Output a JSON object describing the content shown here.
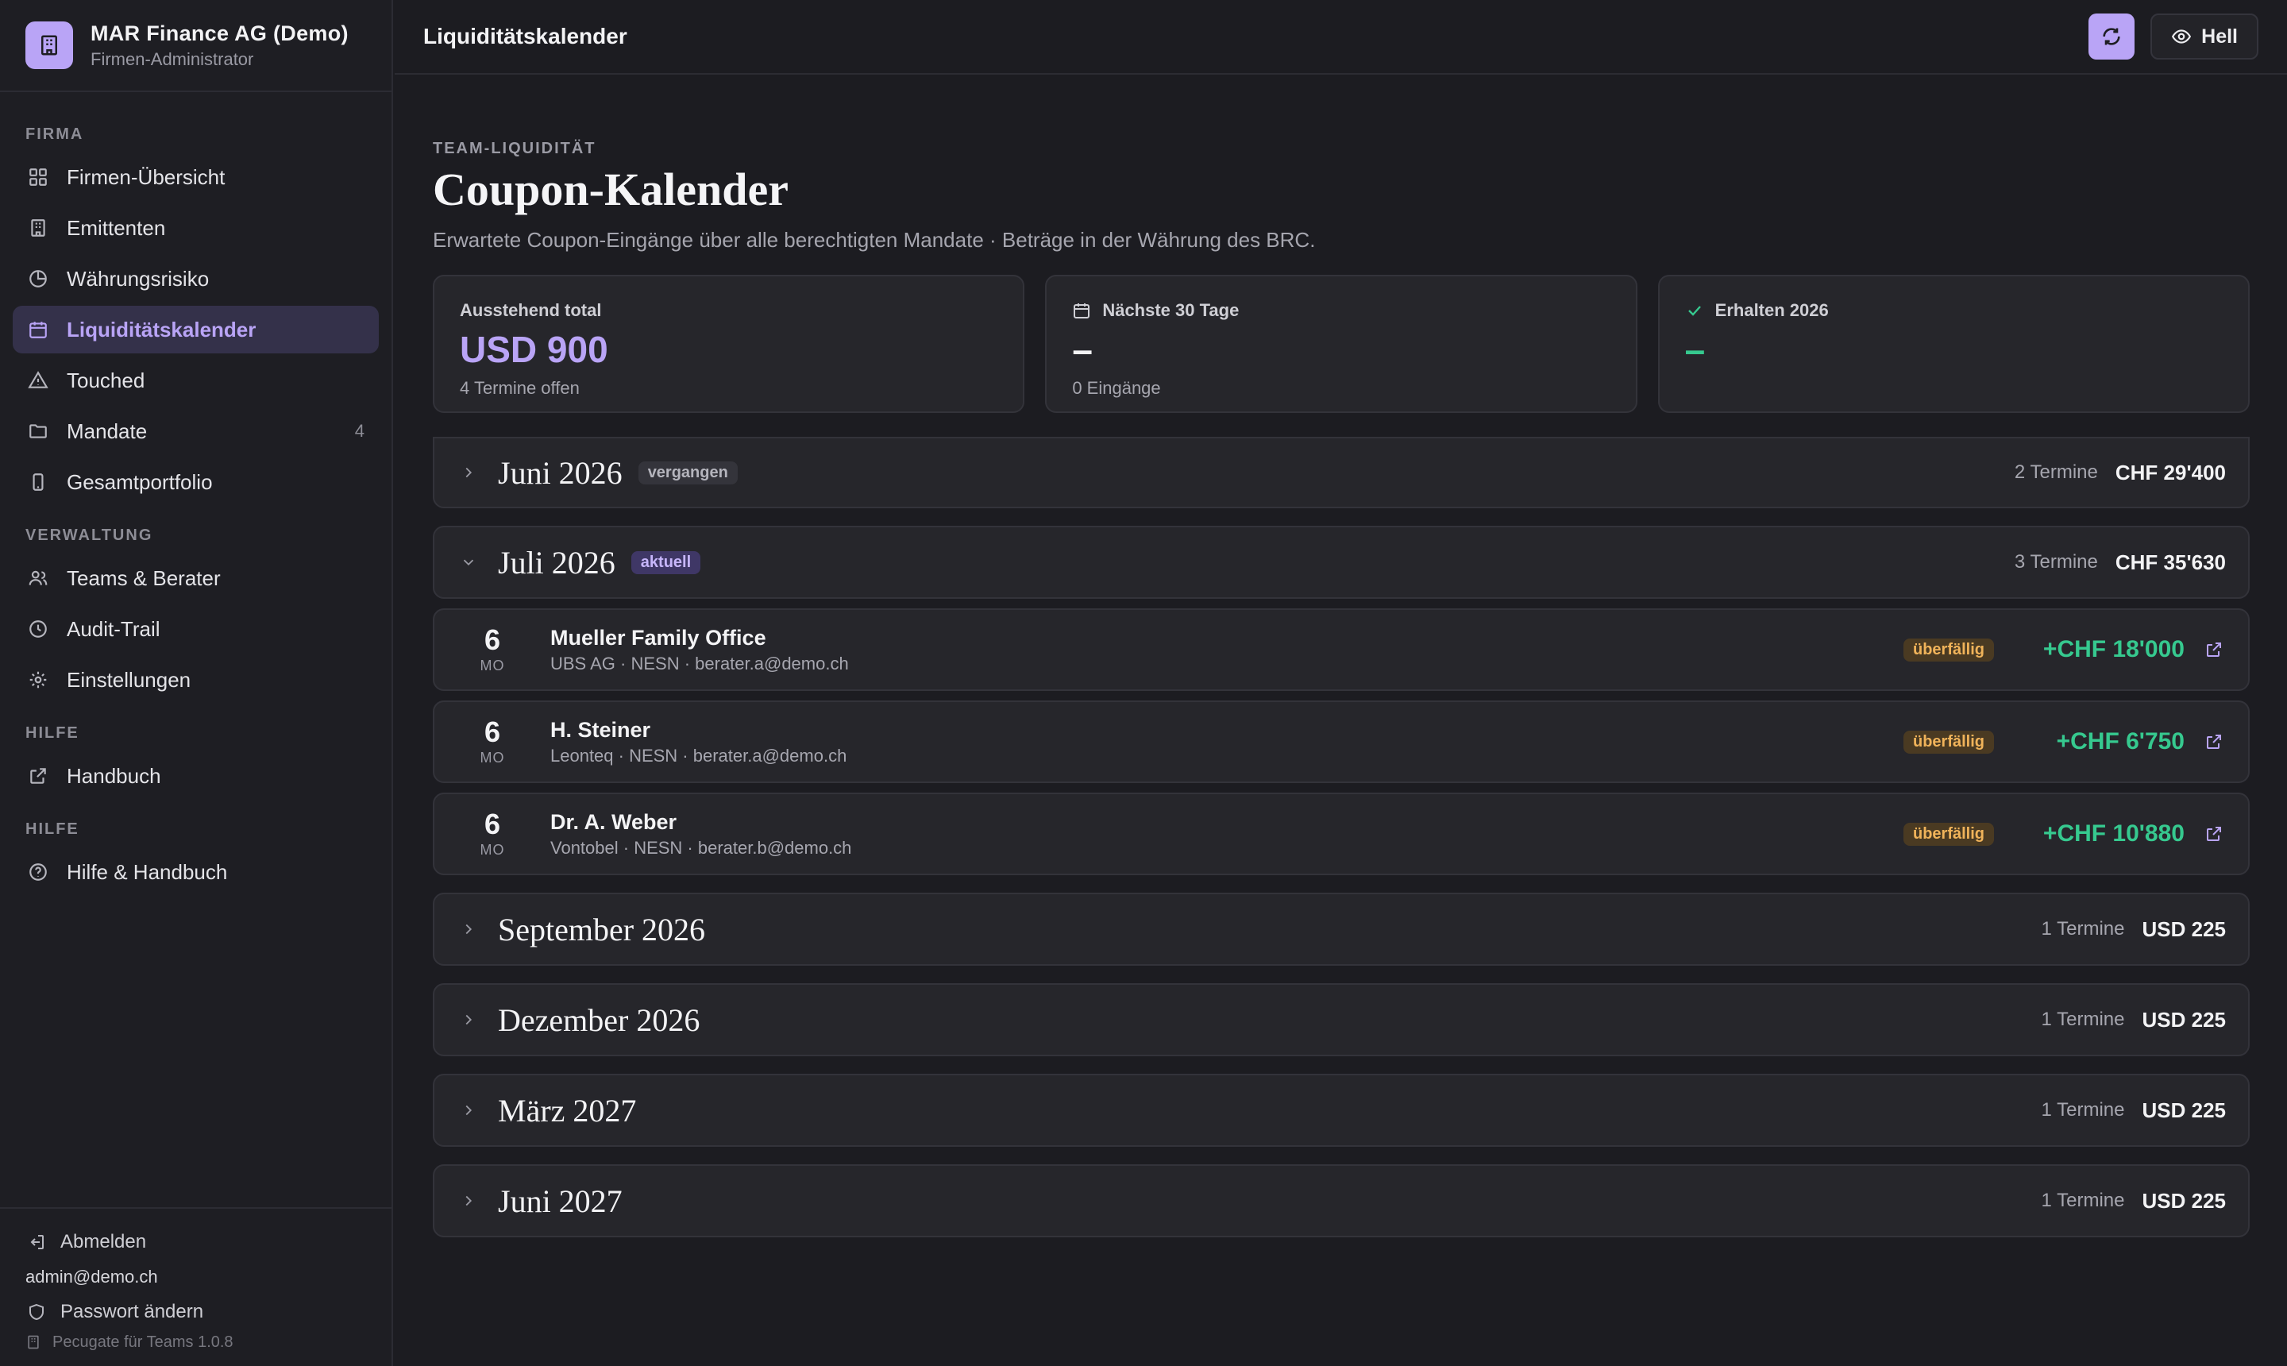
{
  "sidebar": {
    "company": "MAR Finance AG (Demo)",
    "role": "Firmen-Administrator",
    "sections": {
      "firma": "FIRMA",
      "verwaltung": "VERWALTUNG",
      "hilfe1": "HILFE",
      "hilfe2": "HILFE"
    },
    "items": {
      "overview": "Firmen-Übersicht",
      "issuers": "Emittenten",
      "currency_risk": "Währungsrisiko",
      "liquidity": "Liquiditätskalender",
      "touched": "Touched",
      "mandates": "Mandate",
      "mandates_count": "4",
      "portfolio": "Gesamtportfolio",
      "teams": "Teams & Berater",
      "audit": "Audit-Trail",
      "settings": "Einstellungen",
      "manual": "Handbuch",
      "help": "Hilfe & Handbuch"
    },
    "footer": {
      "logout": "Abmelden",
      "email": "admin@demo.ch",
      "password": "Passwort ändern",
      "version": "Pecugate für Teams 1.0.8"
    }
  },
  "topbar": {
    "title": "Liquiditätskalender",
    "theme_label": "Hell"
  },
  "main": {
    "eyebrow": "TEAM-LIQUIDITÄT",
    "title": "Coupon-Kalender",
    "subtitle": "Erwartete Coupon-Eingänge über alle berechtigten Mandate · Beträge in der Währung des BRC.",
    "stats": {
      "outstanding": {
        "label": "Ausstehend total",
        "value": "USD 900",
        "note": "4 Termine offen"
      },
      "next30": {
        "label": "Nächste 30 Tage",
        "value": "–",
        "note": "0 Eingänge"
      },
      "received": {
        "label": "Erhalten 2026",
        "value": "–"
      }
    },
    "months": {
      "m0": {
        "name": "Juni 2026",
        "badge": "vergangen",
        "count": "2 Termine",
        "total": "CHF 29'400"
      },
      "m1": {
        "name": "Juli 2026",
        "badge": "aktuell",
        "count": "3 Termine",
        "total": "CHF 35'630"
      },
      "m2": {
        "name": "September 2026",
        "count": "1 Termine",
        "total": "USD 225"
      },
      "m3": {
        "name": "Dezember 2026",
        "count": "1 Termine",
        "total": "USD 225"
      },
      "m4": {
        "name": "März 2027",
        "count": "1 Termine",
        "total": "USD 225"
      },
      "m5": {
        "name": "Juni 2027",
        "count": "1 Termine",
        "total": "USD 225"
      }
    },
    "entries": [
      {
        "day": "6",
        "weekday": "MO",
        "name": "Mueller Family Office",
        "meta": "UBS AG · NESN · berater.a@demo.ch",
        "status": "überfällig",
        "amount": "+CHF 18'000"
      },
      {
        "day": "6",
        "weekday": "MO",
        "name": "H. Steiner",
        "meta": "Leonteq · NESN · berater.a@demo.ch",
        "status": "überfällig",
        "amount": "+CHF 6'750"
      },
      {
        "day": "6",
        "weekday": "MO",
        "name": "Dr. A. Weber",
        "meta": "Vontobel · NESN · berater.b@demo.ch",
        "status": "überfällig",
        "amount": "+CHF 10'880"
      }
    ]
  },
  "icons": {
    "brand": "building-icon",
    "overview": "grid-icon",
    "issuers": "building-icon",
    "currency_risk": "pie-chart-icon",
    "liquidity": "calendar-icon",
    "touched": "warning-triangle-icon",
    "mandates": "folder-icon",
    "portfolio": "phone-icon",
    "teams": "users-icon",
    "audit": "clock-icon",
    "settings": "gear-icon",
    "manual": "external-link-icon",
    "help": "help-circle-icon",
    "refresh": "refresh-icon",
    "theme": "eye-icon"
  },
  "colors": {
    "accent": "#b9a4f6",
    "positive": "#36c98f",
    "warning": "#f0b35a",
    "background": "#1c1c21"
  }
}
